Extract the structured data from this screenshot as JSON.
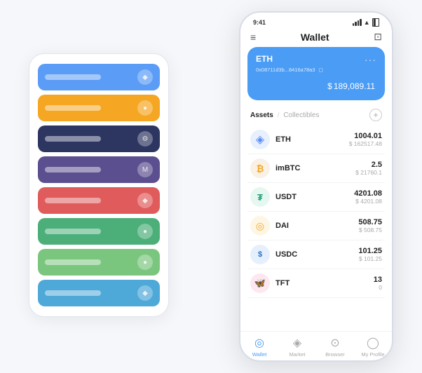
{
  "scene": {
    "cardStack": {
      "cards": [
        {
          "color": "card-blue",
          "iconText": "◆"
        },
        {
          "color": "card-orange",
          "iconText": "●"
        },
        {
          "color": "card-dark",
          "iconText": "⚙"
        },
        {
          "color": "card-purple",
          "iconText": "M"
        },
        {
          "color": "card-red",
          "iconText": "◆"
        },
        {
          "color": "card-green1",
          "iconText": "●"
        },
        {
          "color": "card-green2",
          "iconText": "●"
        },
        {
          "color": "card-skyblue",
          "iconText": "◆"
        }
      ]
    },
    "phone": {
      "statusBar": {
        "time": "9:41",
        "signal": "●●●",
        "wifi": "▲",
        "battery": "▐"
      },
      "header": {
        "menuIcon": "≡",
        "title": "Wallet",
        "scanIcon": "⊡"
      },
      "ethCard": {
        "label": "ETH",
        "address": "0x08711d3b...8416a78a3",
        "addressSuffix": "◻",
        "dots": "···",
        "currencySymbol": "$",
        "balance": "189,089.11"
      },
      "assetsTabs": {
        "active": "Assets",
        "separator": "/",
        "inactive": "Collectibles"
      },
      "assets": [
        {
          "name": "ETH",
          "icon": "◈",
          "iconBg": "#e8f0fd",
          "iconColor": "#5b8cf7",
          "amount": "1004.01",
          "usd": "$ 162517.48"
        },
        {
          "name": "imBTC",
          "icon": "₿",
          "iconBg": "#f9f0e6",
          "iconColor": "#f5a623",
          "amount": "2.5",
          "usd": "$ 21760.1"
        },
        {
          "name": "USDT",
          "icon": "₮",
          "iconBg": "#e6f7f0",
          "iconColor": "#26a17b",
          "amount": "4201.08",
          "usd": "$ 4201.08"
        },
        {
          "name": "DAI",
          "icon": "◉",
          "iconBg": "#fef6e4",
          "iconColor": "#f5a623",
          "amount": "508.75",
          "usd": "$ 508.75"
        },
        {
          "name": "USDC",
          "icon": "$",
          "iconBg": "#e6f0fd",
          "iconColor": "#2775ca",
          "amount": "101.25",
          "usd": "$ 101.25"
        },
        {
          "name": "TFT",
          "icon": "🦋",
          "iconBg": "#fde8f0",
          "iconColor": "#e05c8a",
          "amount": "13",
          "usd": "0"
        }
      ],
      "bottomNav": [
        {
          "icon": "◎",
          "label": "Wallet",
          "active": true
        },
        {
          "icon": "◈",
          "label": "Market",
          "active": false
        },
        {
          "icon": "⊙",
          "label": "Browser",
          "active": false
        },
        {
          "icon": "◯",
          "label": "My Profile",
          "active": false
        }
      ]
    }
  }
}
